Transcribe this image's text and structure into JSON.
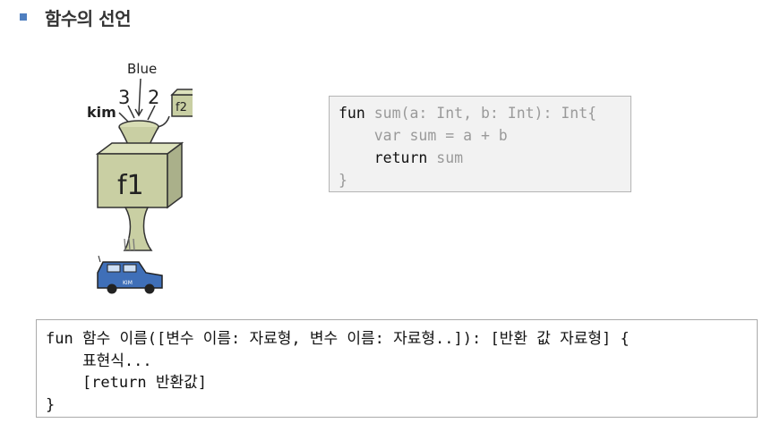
{
  "header": {
    "title": "함수의 선언"
  },
  "illustration": {
    "inputs": [
      "Blue",
      "3",
      "2",
      "kim"
    ],
    "box_label": "f1",
    "side_box_label": "f2",
    "car_label": "KIM"
  },
  "example_code": {
    "line1_kw": "fun",
    "line1_rest": " sum(a: Int, b: Int): Int{",
    "line2": "    var sum = a + b",
    "line3_indent": "    ",
    "line3_kw": "return",
    "line3_rest": " sum",
    "line4": "}"
  },
  "syntax": {
    "line1": "fun 함수 이름([변수 이름: 자료형, 변수 이름: 자료형..]): [반환 값 자료형] {",
    "line2": "    표현식...",
    "line3": "    [return 반환값]",
    "line4": "}"
  },
  "colors": {
    "bullet": "#4f7fc0",
    "box": "#c9cfa3",
    "car": "#3f6fb8"
  }
}
